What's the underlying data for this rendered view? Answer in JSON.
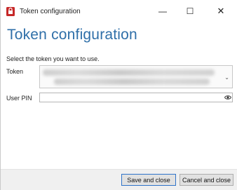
{
  "window": {
    "title": "Token configuration",
    "controls": {
      "minimize": "—",
      "maximize": "☐",
      "close": "✕"
    },
    "icon": "app-icon-red"
  },
  "header": {
    "title": "Token configuration"
  },
  "form": {
    "instruction": "Select the token you want to use.",
    "token_label": "Token",
    "token_value": "",
    "pin_label": "User PIN",
    "pin_value": "",
    "pin_toggle_icon": "eye-icon"
  },
  "footer": {
    "save_label": "Save and close",
    "cancel_label": "Cancel and close"
  },
  "colors": {
    "header": "#2f6fa8",
    "app_icon": "#c62828",
    "primary_border": "#2f73c9"
  }
}
